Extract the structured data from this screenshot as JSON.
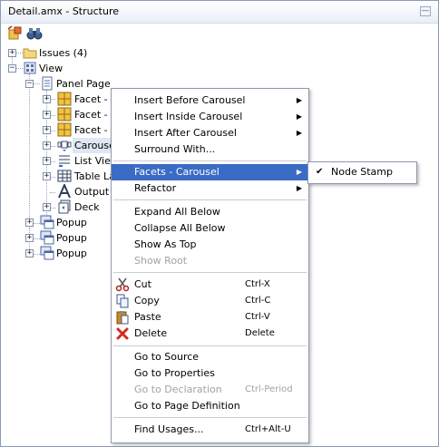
{
  "window": {
    "title": "Detail.amx - Structure",
    "minimize_label": "—"
  },
  "tree": {
    "nodes": [
      {
        "label": "Issues (4)"
      },
      {
        "label": "View"
      },
      {
        "label": "Panel Page"
      },
      {
        "label": "Facet - h"
      },
      {
        "label": "Facet - p"
      },
      {
        "label": "Facet - s"
      },
      {
        "label": "Carousel"
      },
      {
        "label": "List View"
      },
      {
        "label": "Table La"
      },
      {
        "label": "Output T"
      },
      {
        "label": "Deck"
      },
      {
        "label": "Popup"
      },
      {
        "label": "Popup"
      },
      {
        "label": "Popup"
      }
    ]
  },
  "menu": {
    "items": [
      {
        "label": "Insert Before Carousel"
      },
      {
        "label": "Insert Inside Carousel"
      },
      {
        "label": "Insert After Carousel"
      },
      {
        "label": "Surround With..."
      },
      {
        "label": "Facets - Carousel"
      },
      {
        "label": "Refactor"
      },
      {
        "label": "Expand All Below"
      },
      {
        "label": "Collapse All Below"
      },
      {
        "label": "Show As Top"
      },
      {
        "label": "Show Root"
      },
      {
        "label": "Cut",
        "shortcut": "Ctrl-X"
      },
      {
        "label": "Copy",
        "shortcut": "Ctrl-C"
      },
      {
        "label": "Paste",
        "shortcut": "Ctrl-V"
      },
      {
        "label": "Delete",
        "shortcut": "Delete"
      },
      {
        "label": "Go to Source"
      },
      {
        "label": "Go to Properties"
      },
      {
        "label": "Go to Declaration",
        "shortcut": "Ctrl-Period"
      },
      {
        "label": "Go to Page Definition"
      },
      {
        "label": "Find Usages...",
        "shortcut": "Ctrl+Alt-U"
      }
    ]
  },
  "submenu": {
    "items": [
      {
        "label": "Node Stamp",
        "checked": true,
        "check_glyph": "✔"
      }
    ]
  },
  "colors": {
    "highlight": "#3a6bc5",
    "selection": "#dfe7f3"
  }
}
